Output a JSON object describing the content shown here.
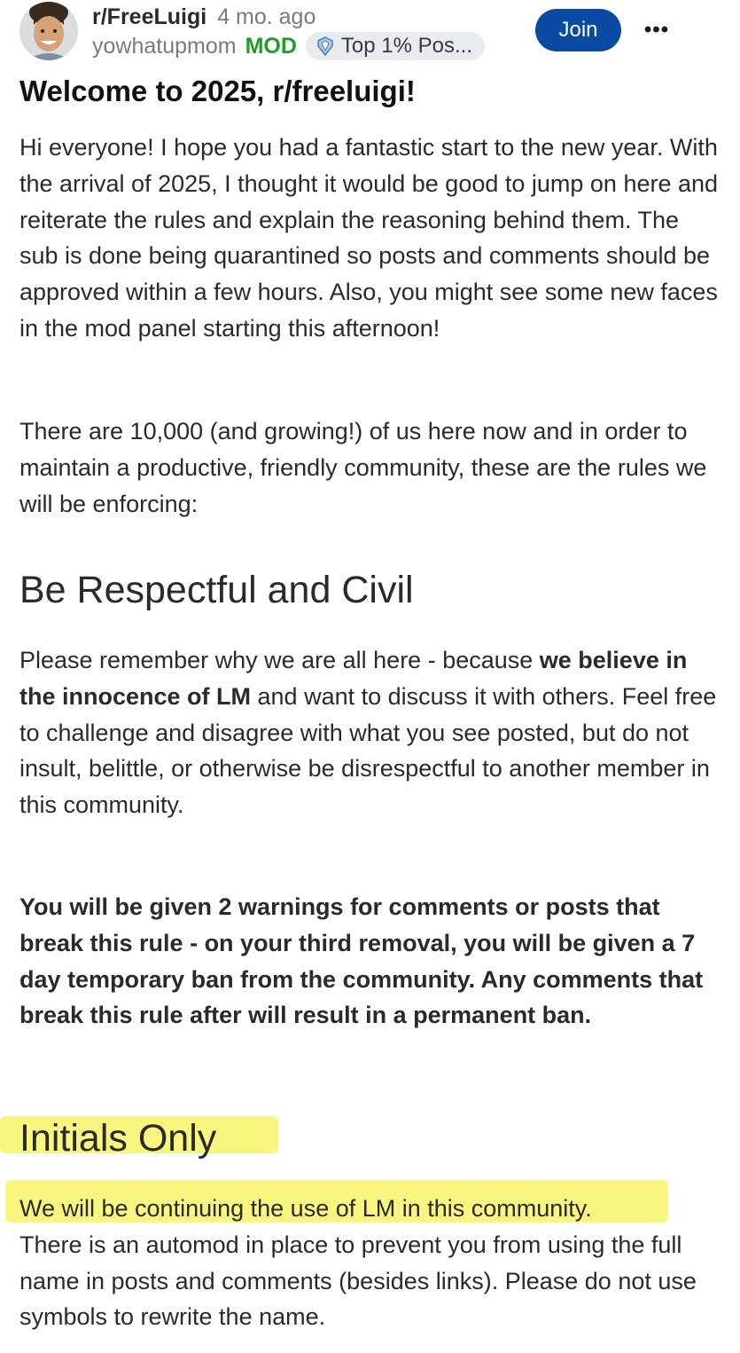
{
  "post": {
    "subreddit": "r/FreeLuigi",
    "age": "4 mo. ago",
    "username": "yowhatupmom",
    "mod_badge": "MOD",
    "flair": "Top 1% Pos...",
    "join_label": "Join",
    "more_label": "•••",
    "title": "Welcome to 2025, r/freeluigi!"
  },
  "body": {
    "p1": "Hi everyone! I hope you had a fantastic start to the new year. With the arrival of 2025, I thought it would be good to jump on here and reiterate the rules and explain the reasoning behind them. The sub is done being quarantined so posts and comments should be approved within a few hours. Also, you might see some new faces in the mod panel starting this afternoon!",
    "p2": "There are 10,000 (and growing!) of us here now and in order to maintain a productive, friendly community, these are the rules we will be enforcing:",
    "h1": "Be Respectful and Civil",
    "p3_a": "Please remember why we are all here - because ",
    "p3_bold": "we believe in the innocence of LM",
    "p3_b": " and want to discuss it with others. Feel free to challenge and disagree with what you see posted, but do not insult, belittle, or otherwise be disrespectful to another member in this community.",
    "p4": "You will be given 2 warnings for comments or posts that break this rule - on your third removal, you will be given a 7 day temporary ban from the community. Any comments that break this rule after will result in a permanent ban.",
    "h2": "Initials Only",
    "p5_a": "We will be continuing the use of LM in this community.",
    "p5_b": "There is an automod in place to prevent you from using the full name in posts and comments (besides links). Please do not use symbols to rewrite the name."
  },
  "colors": {
    "join_button": "#0b4aa3",
    "mod_badge": "#1f9c2a",
    "highlight": "#f7f56a",
    "flair_bg": "#e8ecef"
  },
  "icons": {
    "avatar": "user-avatar-photo",
    "flair": "achievement-badge-icon",
    "more": "more-options-icon"
  }
}
